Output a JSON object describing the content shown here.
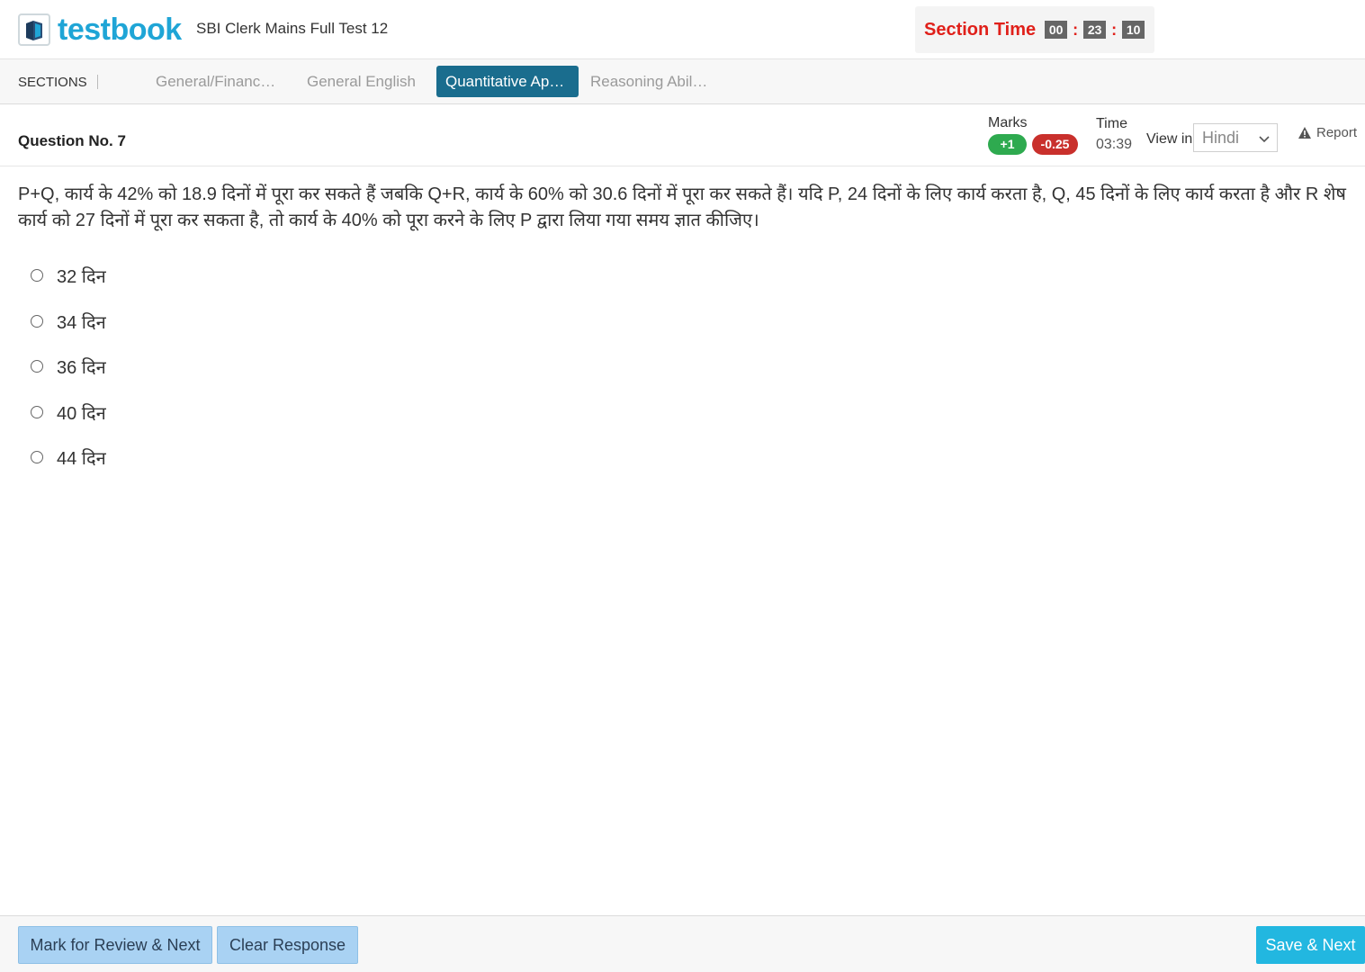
{
  "header": {
    "logo_text": "testbook",
    "test_title": "SBI Clerk Mains Full Test 12",
    "section_time_label": "Section Time",
    "timer": {
      "hours": "00",
      "minutes": "23",
      "seconds": "10",
      "sep": ":"
    }
  },
  "sections": {
    "label": "SECTIONS",
    "tabs": [
      {
        "label": "General/Financ…",
        "active": false
      },
      {
        "label": "General English",
        "active": false
      },
      {
        "label": "Quantitative Ap…",
        "active": true
      },
      {
        "label": "Reasoning Abil…",
        "active": false
      }
    ]
  },
  "question": {
    "number_label": "Question No. 7",
    "marks_label": "Marks",
    "marks_positive": "+1",
    "marks_negative": "-0.25",
    "time_label": "Time",
    "time_value": "03:39",
    "view_in_label": "View in",
    "language": "Hindi",
    "report_label": "Report",
    "text": "P+Q, कार्य के 42% को 18.9 दिनों में पूरा कर सकते हैं जबकि Q+R, कार्य के 60% को 30.6 दिनों में पूरा कर सकते हैं। यदि P, 24 दिनों के लिए कार्य करता है, Q, 45 दिनों के लिए कार्य करता है और R शेष कार्य को 27 दिनों में पूरा कर सकता है, तो कार्य के 40% को पूरा करने के लिए P द्वारा लिया गया समय ज्ञात कीजिए।",
    "options": [
      "32 दिन",
      "34 दिन",
      "36 दिन",
      "40 दिन",
      "44 दिन"
    ]
  },
  "footer": {
    "mark_review_label": "Mark for Review & Next",
    "clear_label": "Clear Response",
    "save_label": "Save & Next"
  },
  "colors": {
    "brand": "#1fa5d6",
    "timer_label": "#e0201a",
    "active_tab": "#1a6d8e",
    "positive_badge": "#2eaa4f",
    "negative_badge": "#c9302c",
    "save_button": "#22b7e0"
  }
}
